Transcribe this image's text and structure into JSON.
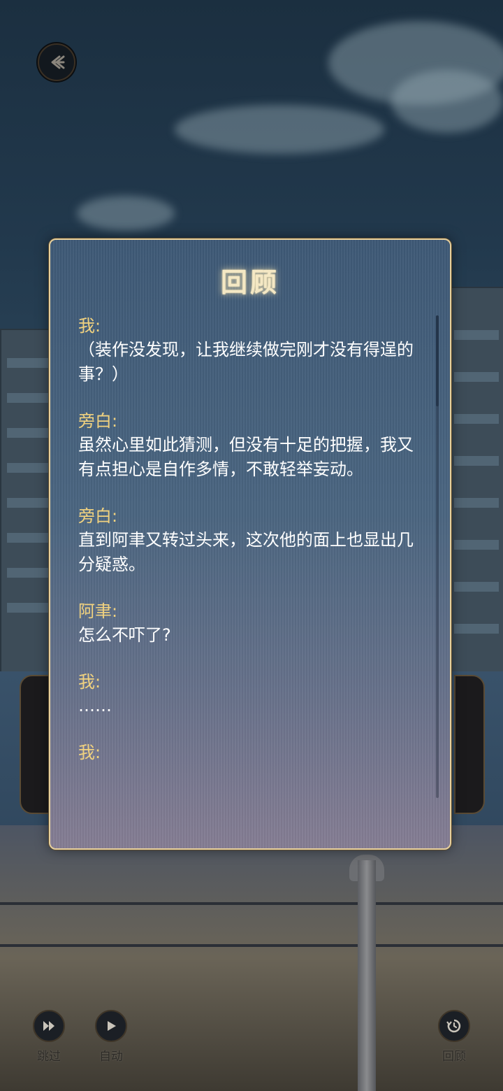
{
  "dialog": {
    "title": "回顾",
    "entries": [
      {
        "speaker": "我:",
        "text": "（装作没发现，让我继续做完刚才没有得逞的事？）"
      },
      {
        "speaker": "旁白:",
        "text": "虽然心里如此猜测，但没有十足的把握，我又有点担心是自作多情，不敢轻举妄动。"
      },
      {
        "speaker": "旁白:",
        "text": "直到阿聿又转过头来，这次他的面上也显出几分疑惑。"
      },
      {
        "speaker": "阿聿:",
        "text": "怎么不吓了?"
      },
      {
        "speaker": "我:",
        "text": "……"
      },
      {
        "speaker": "我:",
        "text": ""
      }
    ]
  },
  "controls": {
    "skip_label": "跳过",
    "auto_label": "自动",
    "review_label": "回顾"
  },
  "icons": {
    "back": "back-arrow-icon",
    "skip": "fast-forward-icon",
    "auto": "play-icon",
    "review": "history-icon"
  },
  "colors": {
    "speaker": "#f1d27f",
    "dialog_border": "#e6cf9c",
    "text": "#ffffff"
  }
}
